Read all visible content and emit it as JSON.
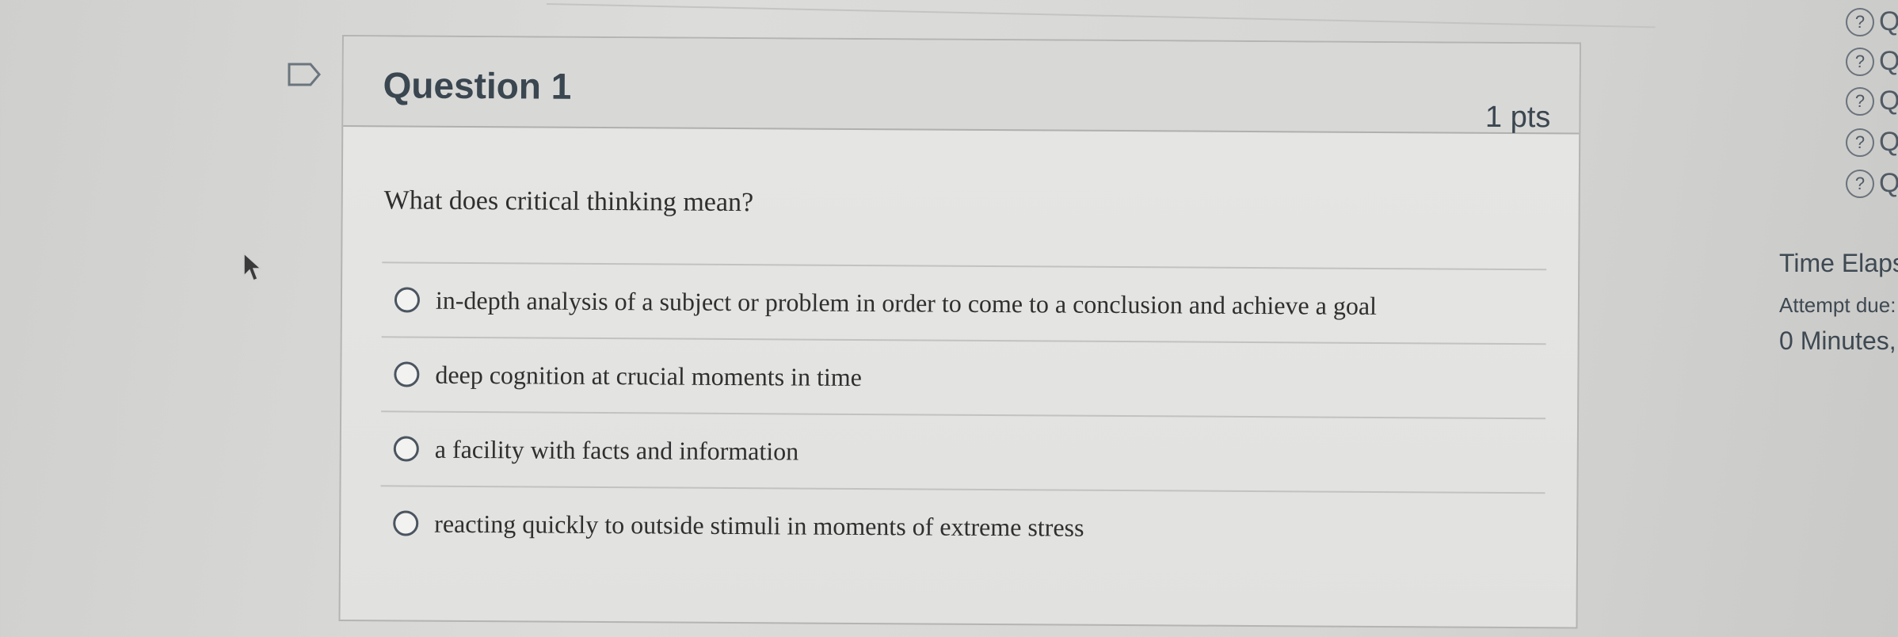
{
  "question": {
    "title": "Question 1",
    "points": "1 pts",
    "text": "What does critical thinking mean?",
    "answers": [
      {
        "label": "in-depth analysis of a subject or problem in order to come to a conclusion and achieve a goal"
      },
      {
        "label": "deep cognition at crucial moments in time"
      },
      {
        "label": "a facility with facts and information"
      },
      {
        "label": "reacting quickly to outside stimuli in moments of extreme stress"
      }
    ]
  },
  "sidebar": {
    "question_links": [
      {
        "icon": "help-icon",
        "label": "Q"
      },
      {
        "icon": "help-icon",
        "label": "Q"
      },
      {
        "icon": "help-icon",
        "label": "Q"
      },
      {
        "icon": "help-icon",
        "label": "Q"
      },
      {
        "icon": "help-icon",
        "label": "Q"
      }
    ],
    "time_elapsed_label": "Time Elaps",
    "attempt_due_label": "Attempt due:",
    "elapsed_value": "0 Minutes,"
  },
  "colors": {
    "card_border": "#b4b4b2",
    "header_bg": "#d8d8d6",
    "text": "#2d3b45"
  }
}
